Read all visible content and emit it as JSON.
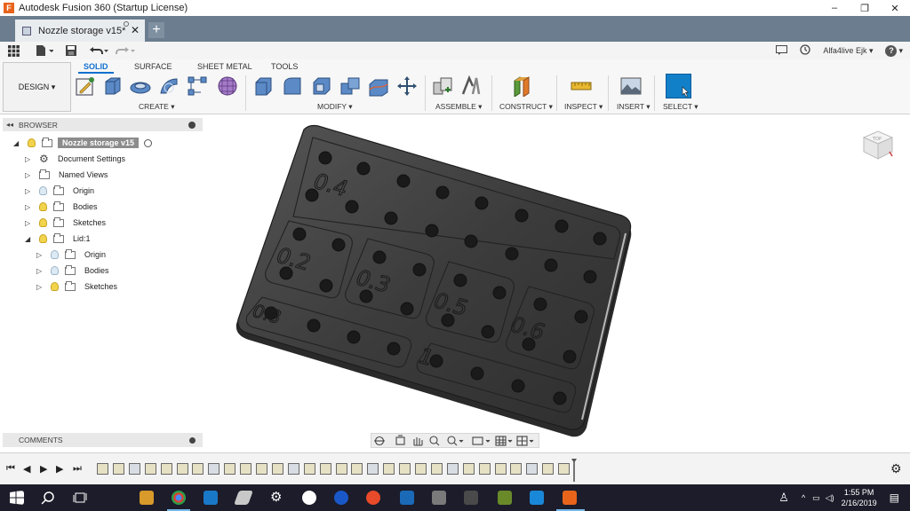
{
  "window": {
    "title": "Autodesk Fusion 360 (Startup License)",
    "app_logo": "F",
    "minimize": "–",
    "maximize": "❐",
    "close": "✕"
  },
  "tabs": {
    "doc_title": "Nozzle storage v15*",
    "close": "✕",
    "new_tab": "+"
  },
  "qat": {
    "user": "Alfa4live Ejk ▾",
    "help": "?▾"
  },
  "ribbon": {
    "workspace": "DESIGN ▾",
    "workspace_tabs": [
      "SOLID",
      "SURFACE",
      "SHEET METAL",
      "TOOLS"
    ],
    "groups": [
      "CREATE ▾",
      "MODIFY ▾",
      "ASSEMBLE ▾",
      "CONSTRUCT ▾",
      "INSPECT ▾",
      "INSERT ▾",
      "SELECT ▾"
    ]
  },
  "browser": {
    "header": "BROWSER",
    "collapse": "◂◂",
    "items": [
      {
        "label": "Nozzle storage v15"
      },
      {
        "label": "Document Settings"
      },
      {
        "label": "Named Views"
      },
      {
        "label": "Origin"
      },
      {
        "label": "Bodies"
      },
      {
        "label": "Sketches"
      },
      {
        "label": "Lid:1"
      },
      {
        "label": "Origin"
      },
      {
        "label": "Bodies"
      },
      {
        "label": "Sketches"
      }
    ]
  },
  "comments": {
    "label": "COMMENTS"
  },
  "model": {
    "labels": [
      "0.4",
      "0.2",
      "0.3",
      "0.5",
      "0.6",
      "0.8",
      "1"
    ]
  },
  "viewcube": {
    "face": "TOP"
  },
  "taskbar": {
    "time": "1:55 PM",
    "date": "2/16/2019"
  },
  "colors": {
    "accent": "#1170cf",
    "tab_bar": "#6b7d8f",
    "model": "#3a3a3a",
    "taskbar": "#1c1c2a",
    "brand": "#e8641b"
  }
}
